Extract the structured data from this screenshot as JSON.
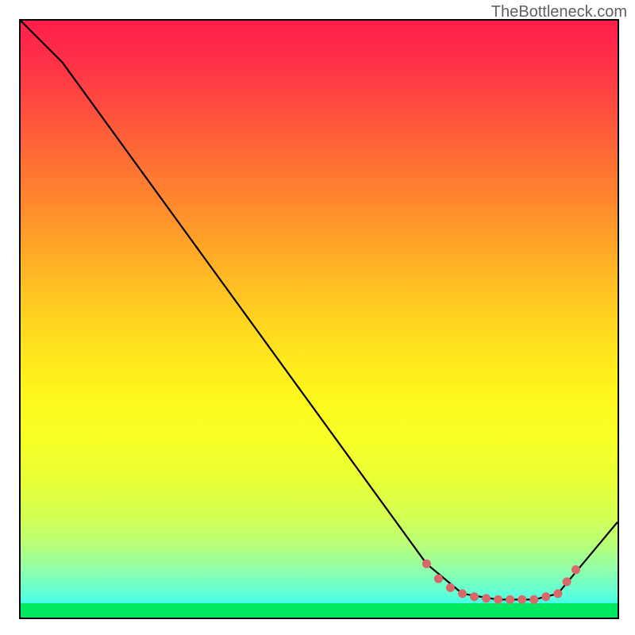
{
  "watermark": "TheBottleneck.com",
  "chart_data": {
    "type": "line",
    "title": "",
    "xlabel": "",
    "ylabel": "",
    "xlim": [
      0,
      100
    ],
    "ylim": [
      0,
      100
    ],
    "series": [
      {
        "name": "curve",
        "points": [
          {
            "x": 0,
            "y": 100
          },
          {
            "x": 7,
            "y": 93
          },
          {
            "x": 68,
            "y": 9
          },
          {
            "x": 74,
            "y": 4
          },
          {
            "x": 80,
            "y": 3
          },
          {
            "x": 86,
            "y": 3
          },
          {
            "x": 90,
            "y": 4
          },
          {
            "x": 100,
            "y": 16
          }
        ]
      },
      {
        "name": "markers",
        "points": [
          {
            "x": 68,
            "y": 9
          },
          {
            "x": 70,
            "y": 6.5
          },
          {
            "x": 72,
            "y": 5
          },
          {
            "x": 74,
            "y": 4
          },
          {
            "x": 76,
            "y": 3.5
          },
          {
            "x": 78,
            "y": 3.2
          },
          {
            "x": 80,
            "y": 3
          },
          {
            "x": 82,
            "y": 3
          },
          {
            "x": 84,
            "y": 3
          },
          {
            "x": 86,
            "y": 3
          },
          {
            "x": 88,
            "y": 3.5
          },
          {
            "x": 90,
            "y": 4
          },
          {
            "x": 91.5,
            "y": 6
          },
          {
            "x": 93,
            "y": 8
          }
        ]
      }
    ],
    "background": {
      "type": "vertical-gradient",
      "stops": [
        {
          "pos": 0,
          "color": "#ff1f4a"
        },
        {
          "pos": 50,
          "color": "#ffda1e"
        },
        {
          "pos": 98,
          "color": "#00e860"
        }
      ]
    }
  }
}
